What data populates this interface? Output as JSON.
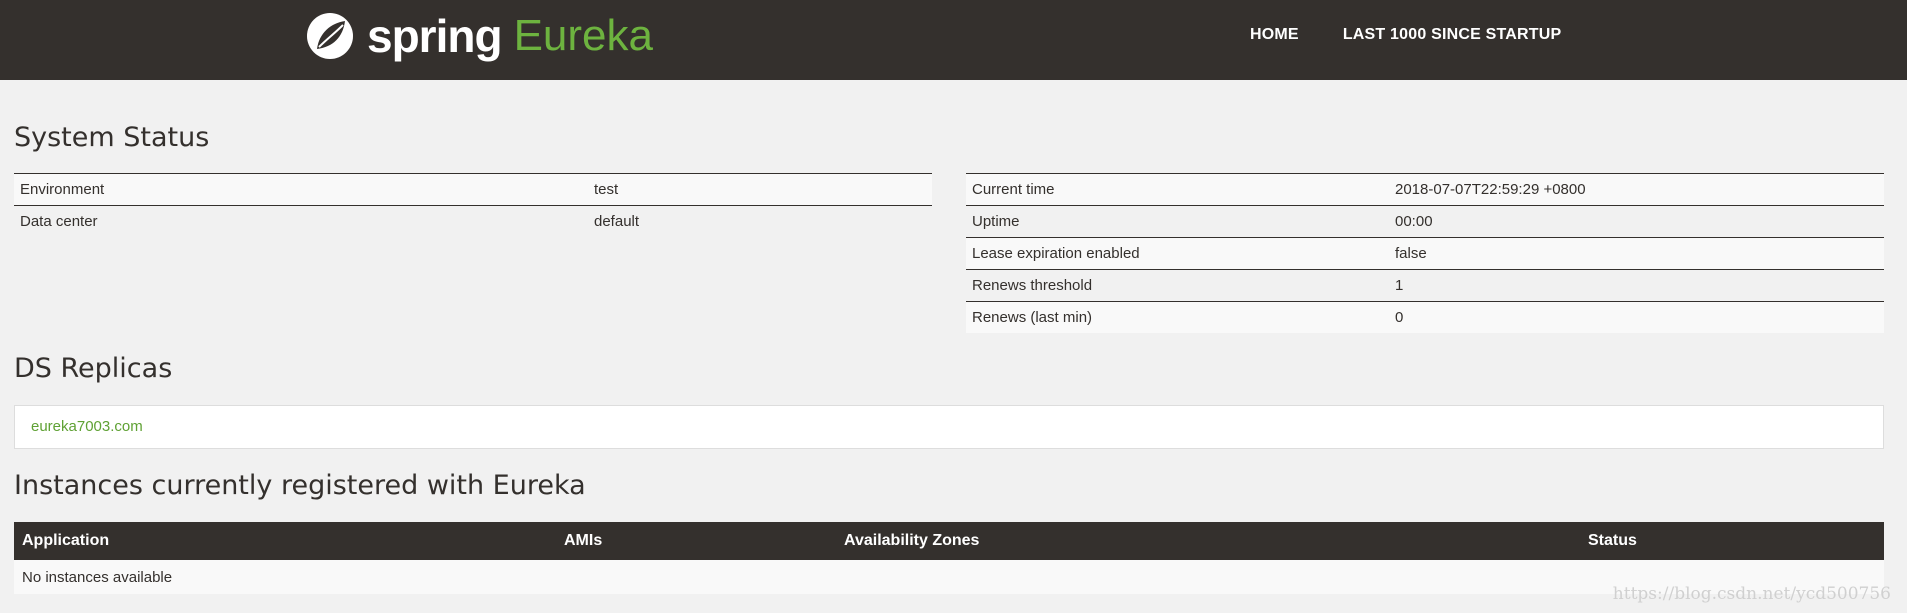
{
  "brand": {
    "spring": "spring",
    "eureka": "Eureka"
  },
  "nav": {
    "home": "HOME",
    "last1000": "LAST 1000 SINCE STARTUP"
  },
  "system_status": {
    "title": "System Status",
    "left": [
      {
        "label": "Environment",
        "value": "test"
      },
      {
        "label": "Data center",
        "value": "default"
      }
    ],
    "right": [
      {
        "label": "Current time",
        "value": "2018-07-07T22:59:29 +0800"
      },
      {
        "label": "Uptime",
        "value": "00:00"
      },
      {
        "label": "Lease expiration enabled",
        "value": "false"
      },
      {
        "label": "Renews threshold",
        "value": "1"
      },
      {
        "label": "Renews (last min)",
        "value": "0"
      }
    ]
  },
  "ds_replicas": {
    "title": "DS Replicas",
    "items": [
      "eureka7003.com"
    ]
  },
  "instances": {
    "title": "Instances currently registered with Eureka",
    "headers": [
      "Application",
      "AMIs",
      "Availability Zones",
      "Status"
    ],
    "empty_text": "No instances available"
  },
  "watermark": "https://blog.csdn.net/ycd500756",
  "colors": {
    "header_bg": "#34302d",
    "accent": "#6db33f",
    "page_bg": "#f1f1f1"
  }
}
